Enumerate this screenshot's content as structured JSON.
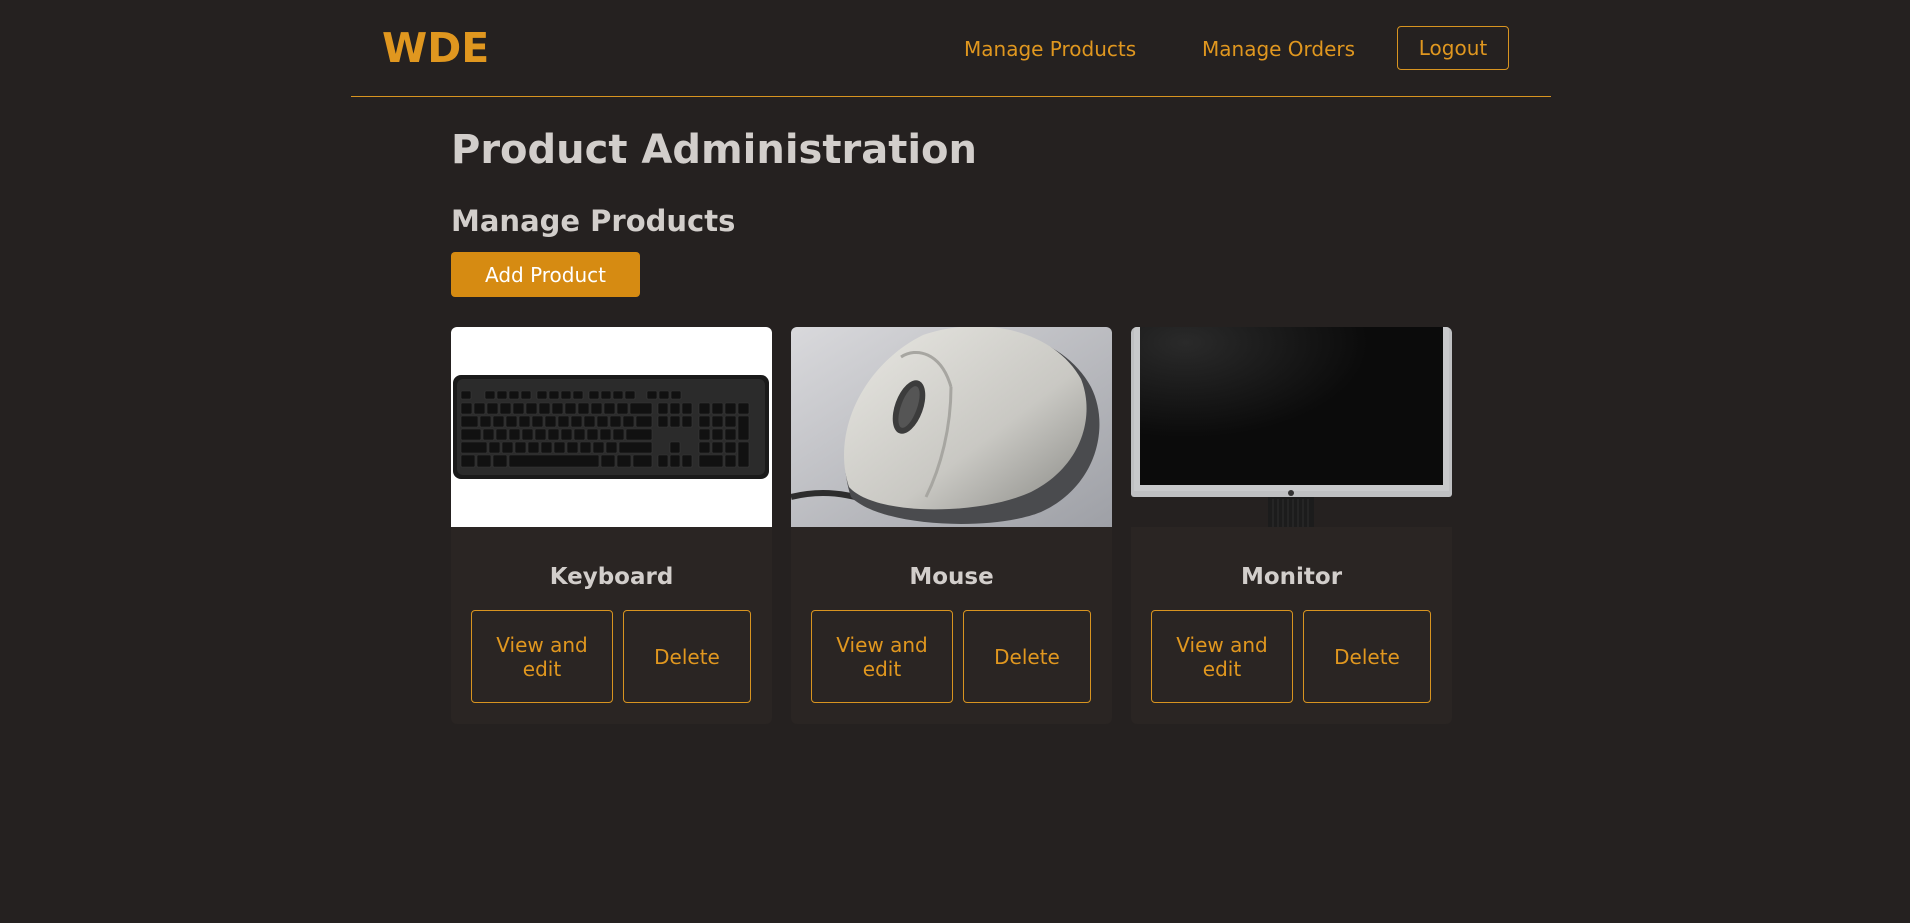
{
  "brand": "WDE",
  "nav": {
    "manage_products": "Manage Products",
    "manage_orders": "Manage Orders",
    "logout": "Logout"
  },
  "page": {
    "title": "Product Administration",
    "section_title": "Manage Products",
    "add_button": "Add Product"
  },
  "products": [
    {
      "name": "Keyboard",
      "view_label": "View and edit",
      "delete_label": "Delete"
    },
    {
      "name": "Mouse",
      "view_label": "View and edit",
      "delete_label": "Delete"
    },
    {
      "name": "Monitor",
      "view_label": "View and edit",
      "delete_label": "Delete"
    }
  ],
  "colors": {
    "background": "#252120",
    "accent": "#e0971f",
    "button_fill": "#d68b12",
    "heading_text": "#d2cecb"
  }
}
